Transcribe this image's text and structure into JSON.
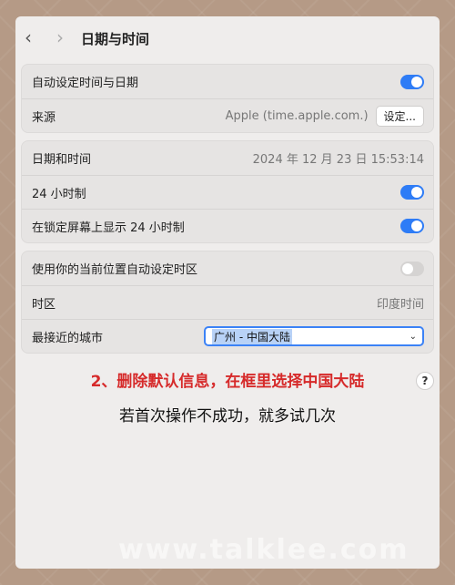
{
  "titlebar": {
    "back_icon": "chevron-left-icon",
    "forward_icon": "chevron-right-icon",
    "title": "日期与时间"
  },
  "group1": {
    "auto_time_label": "自动设定时间与日期",
    "auto_time_on": true,
    "source_label": "来源",
    "source_value": "Apple (time.apple.com.)",
    "source_button": "设定..."
  },
  "group2": {
    "datetime_label": "日期和时间",
    "datetime_value": "2024 年 12 月 23 日  15:53:14",
    "clock24_label": "24 小时制",
    "clock24_on": true,
    "lock24_label": "在锁定屏幕上显示 24 小时制",
    "lock24_on": true
  },
  "group3": {
    "auto_tz_label": "使用你的当前位置自动设定时区",
    "auto_tz_on": false,
    "tz_label": "时区",
    "tz_value": "印度时间",
    "city_label": "最接近的城市",
    "city_value": "广州 - 中国大陆"
  },
  "overlay": {
    "instruction_red": "2、删除默认信息，在框里选择中国大陆",
    "instruction_black": "若首次操作不成功，就多试几次"
  },
  "help_icon": "?",
  "watermark": "www.talklee.com",
  "colors": {
    "accent": "#2e7cf6",
    "instruction_red": "#d62a2a",
    "window_bg": "#efedec",
    "page_bg": "#b59a86"
  }
}
